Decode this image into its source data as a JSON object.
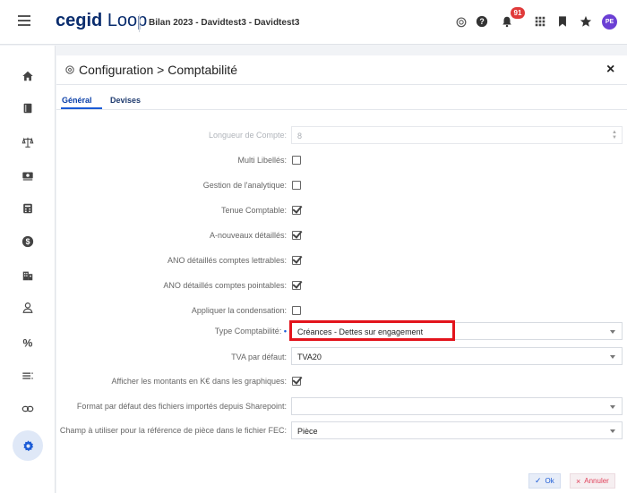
{
  "header": {
    "logo_bold": "cegid",
    "logo_light": "Loop",
    "document_title": "Bilan 2023 - Davidtest3 - Davidtest3",
    "notification_count": "91",
    "avatar_initials": "PE"
  },
  "panel": {
    "title": "Configuration > Comptabilité",
    "tabs": [
      "Général",
      "Devises"
    ]
  },
  "form": {
    "longueur_label": "Longueur de Compte:",
    "longueur_value": "8",
    "multi_libelles_label": "Multi Libellés:",
    "analytique_label": "Gestion de l'analytique:",
    "tenue_label": "Tenue Comptable:",
    "anouveaux_label": "A-nouveaux détaillés:",
    "ano_lettrables_label": "ANO détaillés comptes lettrables:",
    "ano_pointables_label": "ANO détaillés comptes pointables:",
    "condensation_label": "Appliquer la condensation:",
    "type_compta_label": "Type Comptabilité:",
    "type_compta_value": "Créances - Dettes sur engagement",
    "tva_label": "TVA par défaut:",
    "tva_value": "TVA20",
    "afficher_k_label": "Afficher les montants en K€ dans les graphiques:",
    "format_sharepoint_label": "Format par défaut des fichiers importés depuis Sharepoint:",
    "format_sharepoint_value": "",
    "champ_fec_label": "Champ à utiliser pour la référence de pièce dans le fichier FEC:",
    "champ_fec_value": "Pièce",
    "checkboxes": {
      "multi_libelles": false,
      "analytique": false,
      "tenue": true,
      "anouveaux": true,
      "ano_lettrables": true,
      "ano_pointables": true,
      "condensation": false,
      "afficher_k": true
    }
  },
  "buttons": {
    "ok": "Ok",
    "annuler": "Annuler"
  },
  "colors": {
    "accent": "#1b5bd6",
    "brand": "#0a2d6e",
    "highlight": "#e3141c",
    "badge": "#e03a3a",
    "avatar": "#6b3fd4"
  }
}
